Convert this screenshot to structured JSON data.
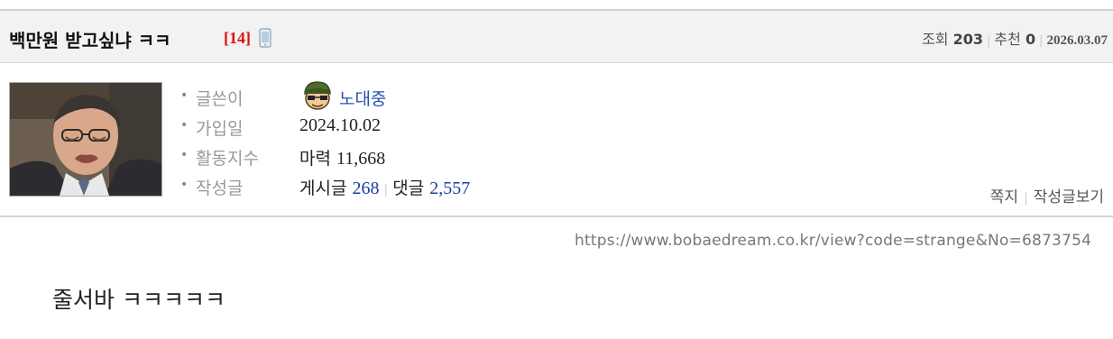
{
  "post": {
    "title": "백만원 받고싶냐 ㅋㅋ",
    "reply_count": "[14]",
    "views_label": "조회",
    "views": "203",
    "recommend_label": "추천",
    "recommend": "0",
    "date": "2026.03.07"
  },
  "author": {
    "writer_label": "글쓴이",
    "nickname": "노대중",
    "joined_label": "가입일",
    "joined": "2024.10.02",
    "activity_label": "활동지수",
    "activity_prefix": "마력",
    "activity_value": "11,668",
    "posts_label": "작성글",
    "posts_prefix": "게시글",
    "posts_count": "268",
    "comments_prefix": "댓글",
    "comments_count": "2,557",
    "message_label": "쪽지",
    "view_posts_label": "작성글보기"
  },
  "url": "https://www.bobaedream.co.kr/view?code=strange&No=6873754",
  "body_text": "줄서바 ㅋㅋㅋㅋㅋ",
  "icons": {
    "mobile": "mobile-phone-icon",
    "level": "soldier-level-icon"
  },
  "colors": {
    "reply_count": "#dd1111",
    "link_blue": "#1c3fa0",
    "header_bg": "#f2f2f2"
  }
}
